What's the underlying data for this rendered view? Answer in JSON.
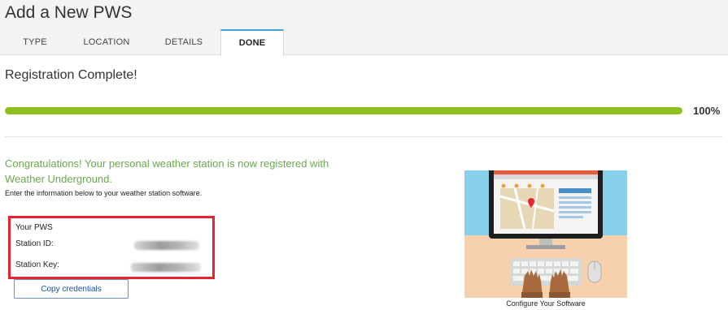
{
  "header": {
    "title": "Add a New PWS",
    "tabs": [
      {
        "label": "TYPE",
        "active": false
      },
      {
        "label": "LOCATION",
        "active": false
      },
      {
        "label": "DETAILS",
        "active": false
      },
      {
        "label": "DONE",
        "active": true
      }
    ]
  },
  "main": {
    "registration_title": "Registration Complete!",
    "progress": {
      "value_percent": 100,
      "label": "100%",
      "color": "#8cc11f"
    },
    "congrats_text": "Congratulations! Your personal weather station is now registered with Weather Underground.",
    "instructions": "Enter the information below to your weather station software.",
    "credentials": {
      "heading": "Your PWS",
      "station_id_label": "Station ID:",
      "station_key_label": "Station Key:",
      "station_id_value": "",
      "station_key_value": "",
      "highlight_color": "#e8232f"
    },
    "copy_button_label": "Copy credentials",
    "illustration": {
      "caption": "Configure Your Software",
      "icon": "computer-setup-illustration"
    }
  },
  "colors": {
    "accent_tab": "#3aa5dc",
    "success_text": "#6aa84f",
    "button_border": "#6a90c6"
  }
}
